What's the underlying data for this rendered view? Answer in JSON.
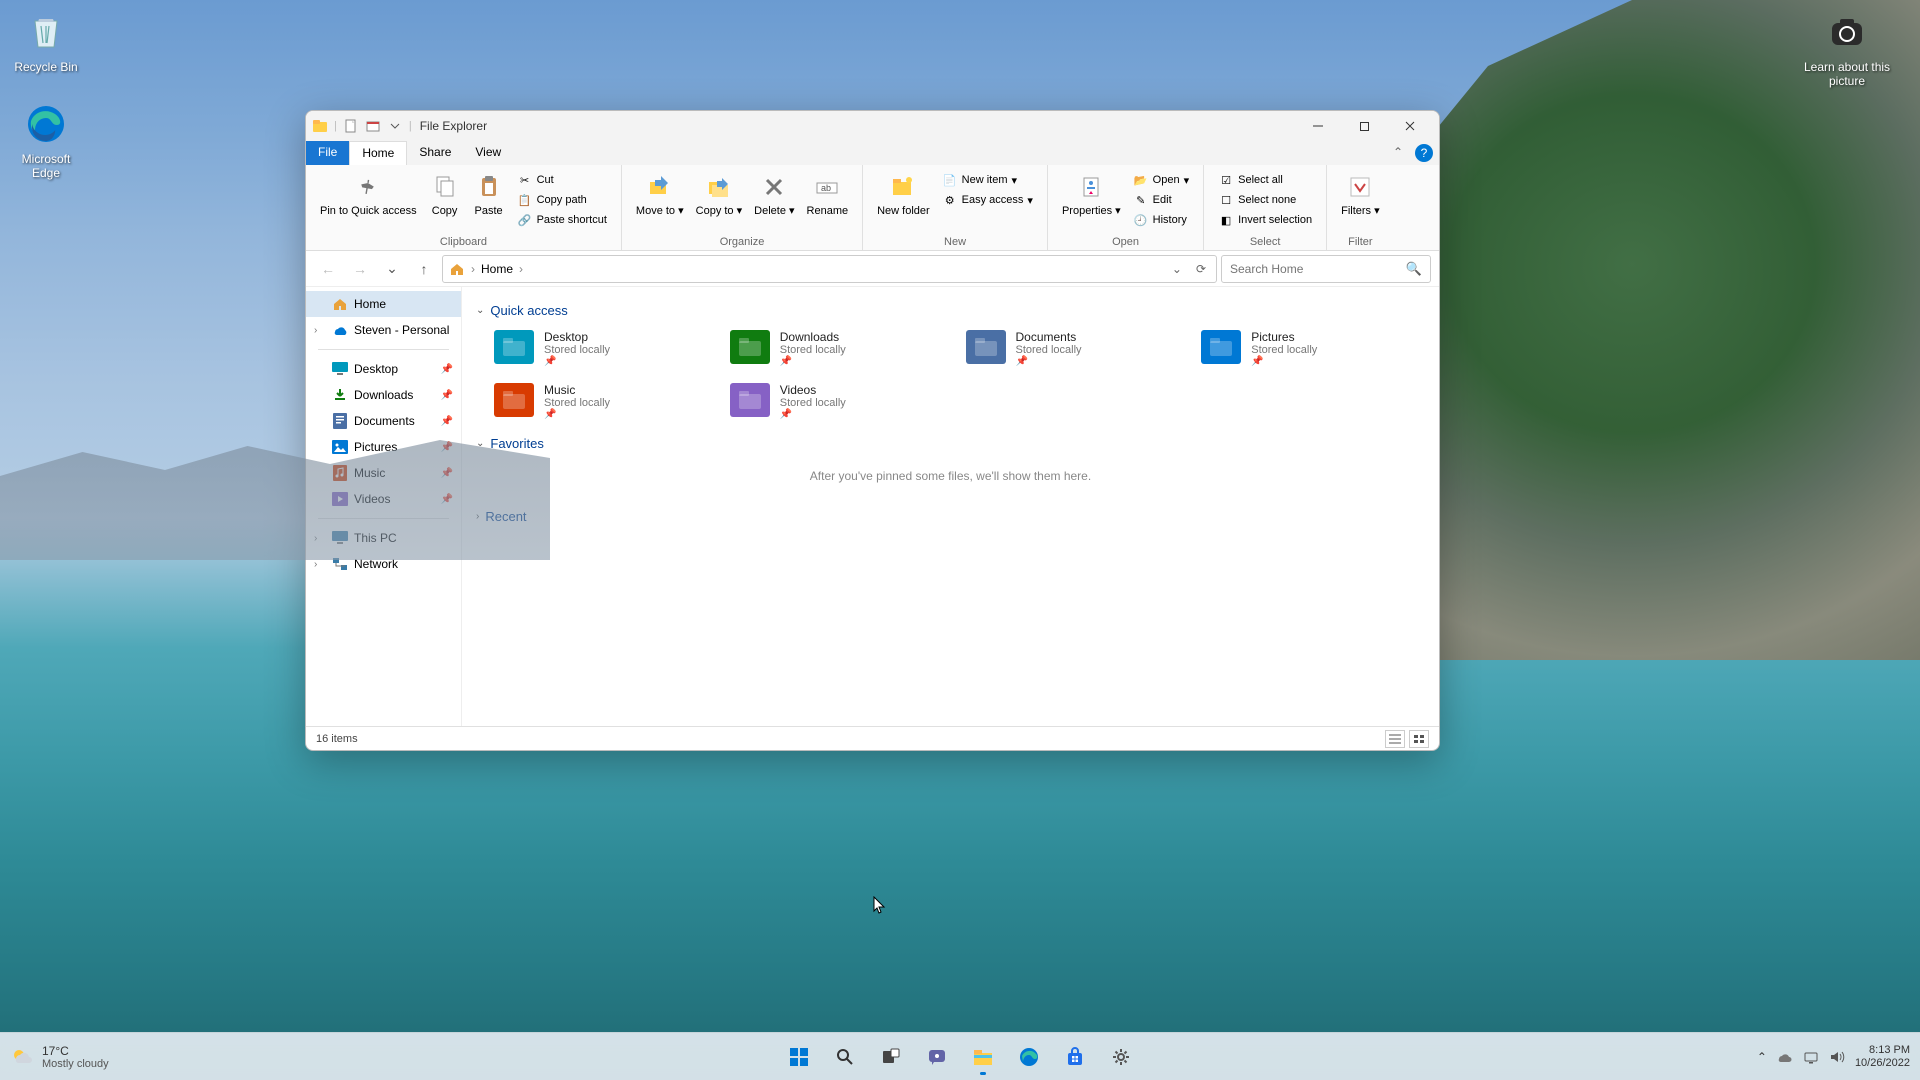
{
  "desktop_icons": {
    "recycle_bin": "Recycle Bin",
    "edge": "Microsoft Edge",
    "learn_about": "Learn about this picture"
  },
  "window": {
    "title": "File Explorer",
    "tabs": {
      "file": "File",
      "home": "Home",
      "share": "Share",
      "view": "View"
    },
    "ribbon": {
      "pin_quick": "Pin to Quick access",
      "copy": "Copy",
      "paste": "Paste",
      "cut": "Cut",
      "copy_path": "Copy path",
      "paste_shortcut": "Paste shortcut",
      "clipboard_grp": "Clipboard",
      "move_to": "Move to",
      "copy_to": "Copy to",
      "delete": "Delete",
      "rename": "Rename",
      "organize_grp": "Organize",
      "new_folder": "New folder",
      "new_item": "New item",
      "easy_access": "Easy access",
      "new_grp": "New",
      "properties": "Properties",
      "open": "Open",
      "edit": "Edit",
      "history": "History",
      "open_grp": "Open",
      "select_all": "Select all",
      "select_none": "Select none",
      "invert": "Invert selection",
      "select_grp": "Select",
      "filters": "Filters",
      "filter_grp": "Filter"
    },
    "breadcrumb": {
      "home": "Home"
    },
    "search_placeholder": "Search Home",
    "sidebar": {
      "home": "Home",
      "personal": "Steven - Personal",
      "desktop": "Desktop",
      "downloads": "Downloads",
      "documents": "Documents",
      "pictures": "Pictures",
      "music": "Music",
      "videos": "Videos",
      "this_pc": "This PC",
      "network": "Network"
    },
    "sections": {
      "quick_access": "Quick access",
      "favorites": "Favorites",
      "favorites_empty": "After you've pinned some files, we'll show them here.",
      "recent": "Recent"
    },
    "quick_items": [
      {
        "name": "Desktop",
        "sub": "Stored locally",
        "color": "#0099bc"
      },
      {
        "name": "Downloads",
        "sub": "Stored locally",
        "color": "#107c10"
      },
      {
        "name": "Documents",
        "sub": "Stored locally",
        "color": "#4a6fa5"
      },
      {
        "name": "Pictures",
        "sub": "Stored locally",
        "color": "#0078d4"
      },
      {
        "name": "Music",
        "sub": "Stored locally",
        "color": "#d83b01"
      },
      {
        "name": "Videos",
        "sub": "Stored locally",
        "color": "#8661c5"
      }
    ],
    "status": "16 items"
  },
  "taskbar": {
    "weather_temp": "17°C",
    "weather_desc": "Mostly cloudy",
    "time": "8:13 PM",
    "date": "10/26/2022"
  }
}
